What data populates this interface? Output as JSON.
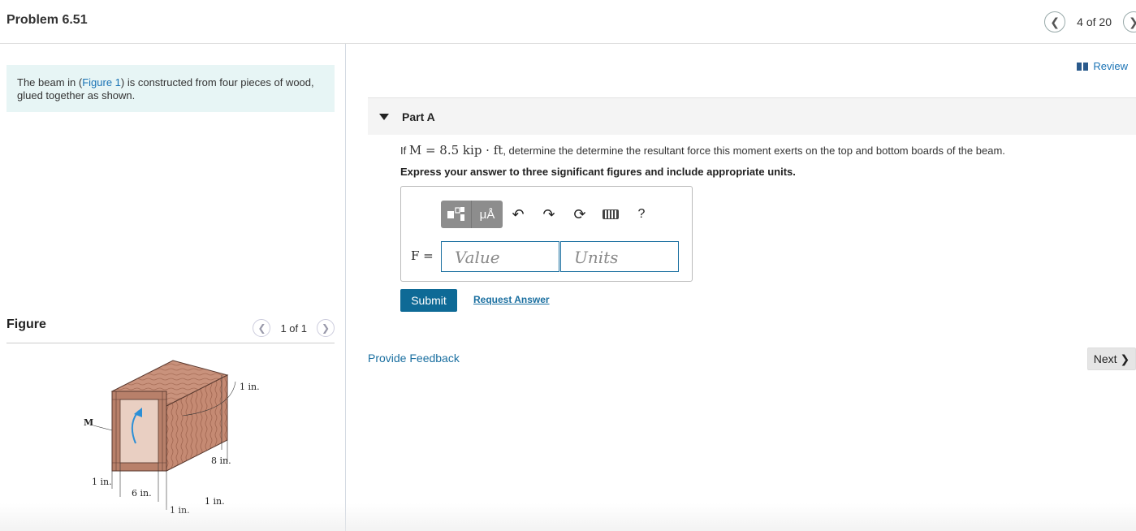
{
  "header": {
    "problem_title": "Problem 6.51",
    "pager_text": "4 of 20",
    "prev_icon": "chevron-left-icon",
    "next_icon": "chevron-right-icon"
  },
  "intro": {
    "text_before": "The beam in (",
    "link": "Figure 1",
    "text_after": ") is constructed from four pieces of wood, glued together as shown."
  },
  "figure": {
    "title": "Figure",
    "pager_text": "1 of 1",
    "labels": {
      "moment": "M",
      "top_thickness": "1 in.",
      "height": "8 in.",
      "left_thickness": "1 in.",
      "width": "6 in.",
      "right_thickness": "1 in.",
      "bottom_thickness": "1 in."
    }
  },
  "review": {
    "label": "Review",
    "icon": "book-icon"
  },
  "part": {
    "label": "Part A",
    "question_prefix": "If ",
    "question_math": "M = 8.5 kip · ft",
    "question_suffix": ", determine the determine the resultant force this moment exerts on the top and bottom boards of the beam.",
    "instruction": "Express your answer to three significant figures and include appropriate units."
  },
  "answer": {
    "variable": "F =",
    "value_placeholder": "Value",
    "units_placeholder": "Units",
    "toolbar": {
      "templates_icon": "templates-icon",
      "units_label": "μÅ",
      "undo_icon": "undo-icon",
      "redo_icon": "redo-icon",
      "reset_icon": "reset-icon",
      "keyboard_icon": "keyboard-icon",
      "help_label": "?"
    }
  },
  "actions": {
    "submit": "Submit",
    "request_answer": "Request Answer",
    "provide_feedback": "Provide Feedback",
    "next": "Next"
  }
}
